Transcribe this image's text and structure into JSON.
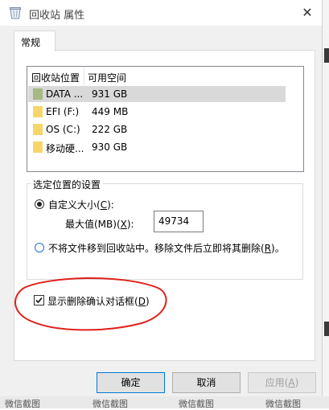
{
  "window": {
    "title": "回收站 属性",
    "close_glyph": "✕"
  },
  "tab": {
    "label": "常规"
  },
  "list": {
    "headers": {
      "location": "回收站位置",
      "space": "可用空间"
    },
    "rows": [
      {
        "name": "DATA ...",
        "space": "931 GB",
        "selected": true
      },
      {
        "name": "EFI (F:)",
        "space": "449 MB",
        "selected": false
      },
      {
        "name": "OS (C:)",
        "space": "222 GB",
        "selected": false
      },
      {
        "name": "移动硬...",
        "space": "930 GB",
        "selected": false
      }
    ]
  },
  "settings": {
    "group_title": "选定位置的设置",
    "custom_size_label": "自定义大小(",
    "custom_size_key": "C",
    "custom_size_tail": "):",
    "max_size_label": "最大值(MB)(",
    "max_size_key": "X",
    "max_size_tail": "):",
    "max_size_value": "49734",
    "no_move_label": "不将文件移到回收站中。移除文件后立即将其删除(",
    "no_move_key": "R",
    "no_move_tail": ")。"
  },
  "confirm": {
    "label": "显示删除确认对话框(",
    "key": "D",
    "tail": ")",
    "checked": true
  },
  "buttons": {
    "ok": "确定",
    "cancel": "取消",
    "apply_text": "应用(",
    "apply_key": "A",
    "apply_tail": ")"
  },
  "desktop": {
    "labels": [
      "微信截图",
      "微信截图",
      "微信截图",
      "微信截图"
    ]
  },
  "colors": {
    "annotation_ellipse": "#e0201a",
    "folder": "#f6d56b",
    "drive_data": "#a7b883",
    "focus_blue": "#0078d7"
  },
  "icons": {
    "title": "recycle-bin-icon",
    "drive_rows": [
      "drive-icon",
      "folder-icon",
      "folder-icon",
      "folder-icon"
    ]
  }
}
